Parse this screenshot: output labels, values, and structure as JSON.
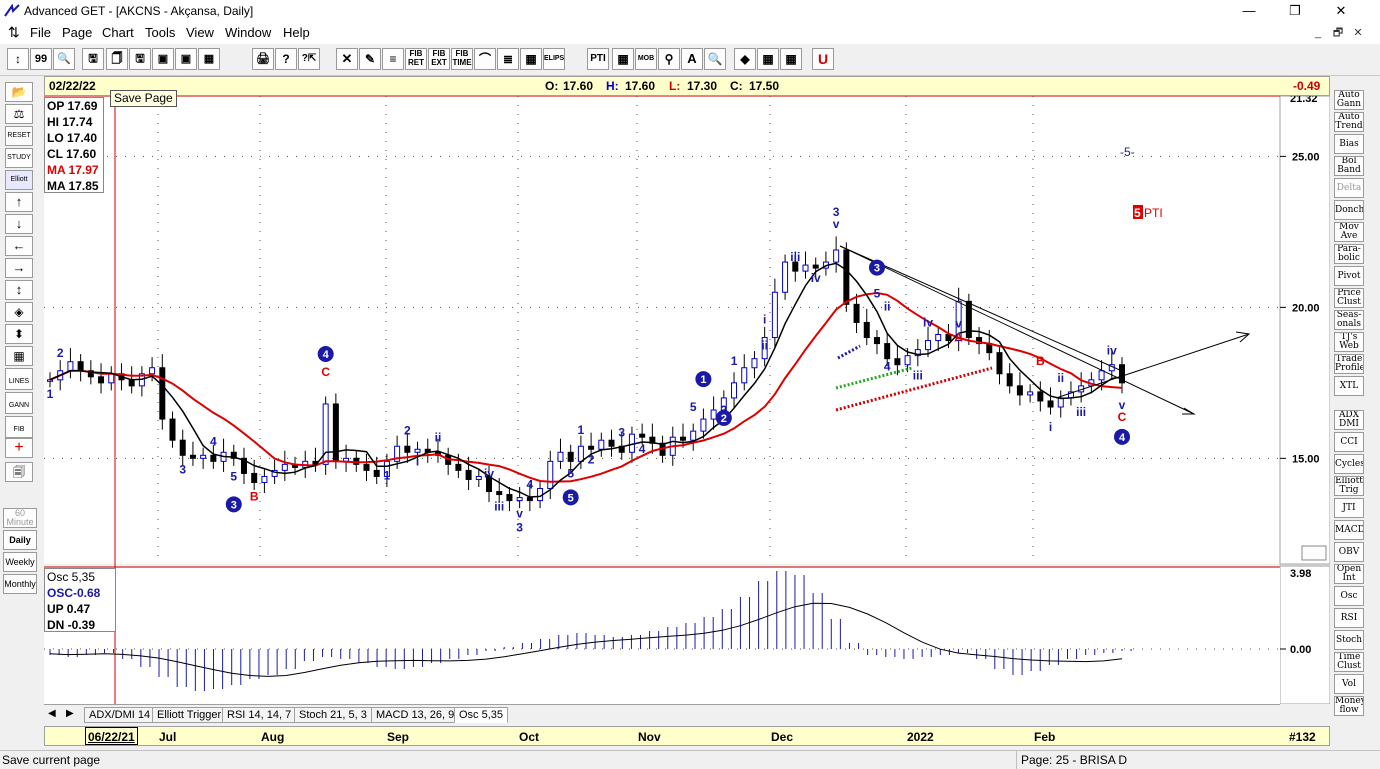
{
  "window": {
    "title": "Advanced GET - [AKCNS - Akçansa, Daily]",
    "minimize": "—",
    "maximize": "❐",
    "close": "✕"
  },
  "menu": [
    "File",
    "Page",
    "Chart",
    "Tools",
    "View",
    "Window",
    "Help"
  ],
  "mdi_buttons": [
    "_",
    "🗗",
    "✕"
  ],
  "toolbar": {
    "items": [
      "↕",
      "99",
      "🔍",
      "🖫",
      "🗍",
      "🖫",
      "▣",
      "▣",
      "▦",
      "🖨",
      "?",
      "?⇱",
      "✕",
      "✎",
      "≡",
      "FIB RET",
      "FIB EXT",
      "FIB TIME",
      "⌒",
      "≣",
      "▦",
      "ELIPS",
      "PTI",
      "▦",
      "MOB",
      "⚲",
      "A",
      "🔍",
      "◆",
      "▦",
      "▦",
      "U"
    ]
  },
  "left_toolbar": {
    "items": [
      "📂",
      "⚖",
      "RESET",
      "STUDY",
      "Elliott",
      "↑",
      "↓",
      "←",
      "→",
      "↕",
      "◈",
      "⬍",
      "▦",
      "LINES",
      "GANN",
      "FIB",
      "+",
      "🗐"
    ],
    "timeframes": [
      "60 Minute",
      "Daily",
      "Weekly",
      "Monthly"
    ]
  },
  "right_toolbar": {
    "items": [
      "Auto Gann",
      "Auto Trend",
      "Bias",
      "Bol Band",
      "Delta",
      "Donch",
      "Mov Ave",
      "Para- bolic",
      "Pivot",
      "Price Clust",
      "Seas- onals",
      "TJ's Web",
      "Trade Profile",
      "XTL",
      "ADX DMI",
      "CCI",
      "Cycles",
      "Elliott Trig",
      "JTI",
      "MACD",
      "OBV",
      "Open Int",
      "Osc",
      "RSI",
      "Stoch",
      "Time Clust",
      "Vol",
      "Money flow"
    ]
  },
  "infobar": {
    "date": "02/22/22",
    "open_label": "O:",
    "open": "17.60",
    "high_label": "H:",
    "high": "17.60",
    "low_label": "L:",
    "low": "17.30",
    "close_label": "C:",
    "close": "17.50",
    "change": "-0.49"
  },
  "tooltip": "Save Page",
  "ohlc_box": {
    "op": "OP 17.69",
    "hi": "HI  17.74",
    "lo": "LO  17.40",
    "cl": "CL  17.60",
    "ma1": "MA 17.97",
    "ma2": "MA 17.85"
  },
  "osc_box": {
    "title": "Osc 5,35",
    "osc": "OSC-0.68",
    "up": "UP   0.47",
    "dn": "DN   -0.39"
  },
  "price_axis": {
    "top": "21.32",
    "ticks": [
      "25.00",
      "20.00",
      "15.00"
    ],
    "osc_top": "3.98",
    "osc_zero": "0.00"
  },
  "chart_annotations": {
    "pti": "PTI",
    "pti_count": "5",
    "wave_5_label": "-5-"
  },
  "tabs": [
    "ADX/DMI 14",
    "Elliott Trigger",
    "RSI 14, 14, 7",
    "Stoch 21, 5, 3",
    "MACD 13, 26, 9",
    "Osc 5,35"
  ],
  "date_axis": {
    "cursor_date": "06/22/21",
    "months": [
      "Jul",
      "Aug",
      "Sep",
      "Oct",
      "Nov",
      "Dec",
      "2022",
      "Feb"
    ],
    "page_num": "#132"
  },
  "status": {
    "left": "Save current page",
    "right": "Page: 25 - BRISA D"
  },
  "colors": {
    "up_candle": "#0000cc",
    "down_candle": "#cc0000",
    "ma_fast": "#000000",
    "ma_slow": "#dd0000",
    "wave_blue": "#1a1aa6",
    "wave_red": "#dd0000"
  },
  "chart_data": [
    {
      "type": "candlestick",
      "title": "AKCNS - Akçansa, Daily",
      "ylim": [
        11.5,
        27
      ],
      "yticks": [
        15.0,
        20.0,
        25.0
      ],
      "x_months": [
        "Jul",
        "Aug",
        "Sep",
        "Oct",
        "Nov",
        "Dec",
        "2022",
        "Feb"
      ],
      "close_series": [
        17.6,
        17.9,
        18.2,
        17.9,
        17.7,
        17.5,
        17.8,
        17.6,
        17.4,
        17.8,
        18.0,
        16.3,
        15.6,
        15.1,
        15.0,
        15.1,
        14.9,
        15.2,
        15.0,
        14.5,
        14.2,
        14.4,
        14.6,
        14.8,
        14.7,
        14.9,
        14.8,
        16.8,
        14.9,
        15.0,
        14.8,
        14.6,
        14.4,
        14.9,
        15.4,
        15.2,
        15.3,
        15.2,
        15.1,
        14.8,
        14.6,
        14.3,
        14.4,
        13.9,
        13.8,
        13.6,
        13.7,
        13.6,
        14.0,
        14.9,
        15.2,
        14.9,
        15.4,
        15.3,
        15.6,
        15.4,
        15.2,
        15.8,
        15.7,
        15.5,
        15.1,
        15.7,
        15.6,
        15.9,
        16.3,
        16.6,
        17.0,
        17.5,
        18.0,
        18.3,
        19.0,
        20.5,
        21.5,
        21.2,
        21.4,
        21.3,
        21.5,
        21.9,
        20.1,
        19.5,
        19.0,
        18.8,
        18.3,
        18.1,
        18.4,
        18.6,
        18.9,
        19.1,
        18.9,
        20.2,
        19.0,
        18.8,
        18.5,
        17.8,
        17.4,
        17.1,
        17.2,
        16.9,
        16.7,
        17.0,
        17.2,
        17.4,
        17.6,
        17.9,
        18.1,
        17.5
      ],
      "series": [
        {
          "name": "MA",
          "value_last": 17.97
        },
        {
          "name": "MA",
          "value_last": 17.85
        }
      ],
      "last_bar": {
        "date": "02/22/22",
        "open": 17.6,
        "high": 17.6,
        "low": 17.3,
        "close": 17.5,
        "change": -0.49
      }
    },
    {
      "type": "bar",
      "title": "Osc 5,35",
      "ylim": [
        -2.2,
        3.98
      ],
      "values": [
        -0.3,
        -0.4,
        -0.3,
        -0.2,
        -0.5,
        -0.9,
        -1.4,
        -1.9,
        -2.1,
        -2.0,
        -1.8,
        -1.5,
        -1.3,
        -1.0,
        -0.6,
        -0.4,
        -0.5,
        -0.7,
        -0.9,
        -1.0,
        -0.9,
        -0.7,
        -0.5,
        -0.3,
        -0.1,
        0.1,
        0.3,
        0.5,
        0.7,
        0.8,
        0.7,
        0.6,
        0.7,
        0.9,
        1.1,
        1.3,
        1.6,
        2.0,
        2.6,
        3.4,
        3.9,
        3.7,
        2.8,
        1.5,
        0.3,
        -0.3,
        -0.4,
        -0.5,
        -0.4,
        -0.3,
        -0.2,
        -0.5,
        -1.0,
        -1.3,
        -1.1,
        -0.8,
        -0.5,
        -0.3,
        -0.2,
        -0.1
      ],
      "osc_last": -0.68,
      "up": 0.47,
      "dn": -0.39
    }
  ]
}
